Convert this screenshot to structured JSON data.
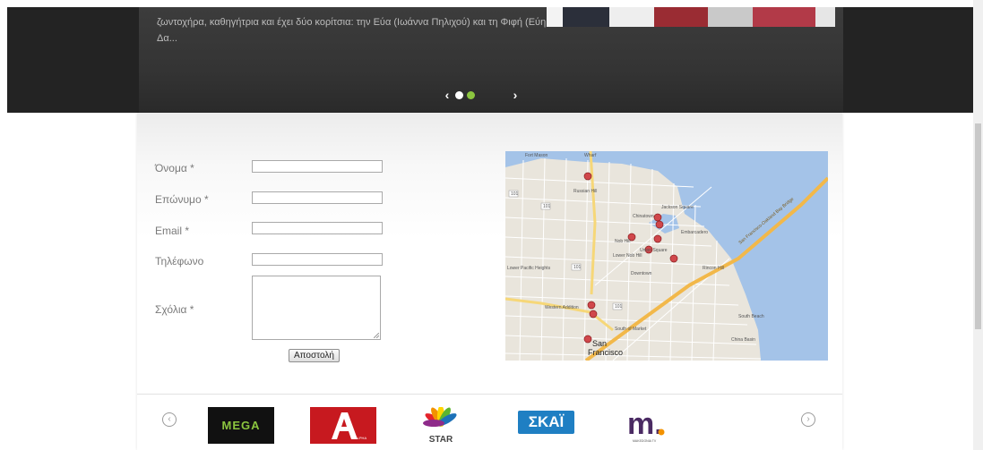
{
  "hero": {
    "text": "ζωντοχήρα, καθηγήτρια και έχει δύο κορίτσια: την Εύα (Ιωάννα Πηλιχού) και τη Φιφή (Εύη Δα...",
    "prev_arrow": "‹",
    "next_arrow": "›",
    "active_dot": 2,
    "dot_count": 2
  },
  "form": {
    "fields": [
      {
        "label": "Όνομα *",
        "value": ""
      },
      {
        "label": "Επώνυμο *",
        "value": ""
      },
      {
        "label": "Email *",
        "value": ""
      },
      {
        "label": "Τηλέφωνο",
        "value": ""
      },
      {
        "label": "Σχόλια *",
        "value": ""
      }
    ],
    "submit_label": "Αποστολή"
  },
  "map": {
    "city_label_1": "San",
    "city_label_2": "Francisco",
    "place_labels": [
      "Fort Mason",
      "Wharf",
      "Russian Hill",
      "Chinatown",
      "Jackson Square",
      "Nob Hill",
      "Lower Nob Hill",
      "Downtown",
      "Rincon Hill",
      "Lower Pacific Heights",
      "Western Addition",
      "South of Market",
      "South Beach",
      "China Basin",
      "Embarcadero",
      "Union Square"
    ],
    "highway_labels": [
      "101",
      "101",
      "101",
      "101"
    ],
    "bridge_label": "San Francisco-Oakland Bay Bridge"
  },
  "carousel": {
    "prev_icon": "‹",
    "next_icon": "›",
    "logos": {
      "mega": "MEGA",
      "alpha": "ALPHA",
      "star": "STAR",
      "skai": "ΣΚΑΪ",
      "macedonia": "m.",
      "macedonia_sub": "MAKEDONIA TV"
    }
  },
  "colors": {
    "hero_bg": "#232323",
    "dot_active": "#8cc63f",
    "map_water": "#a4c3e8",
    "map_land": "#e9e5dc",
    "skai_blue": "#1f7fc3",
    "alpha_red": "#c7191f"
  }
}
